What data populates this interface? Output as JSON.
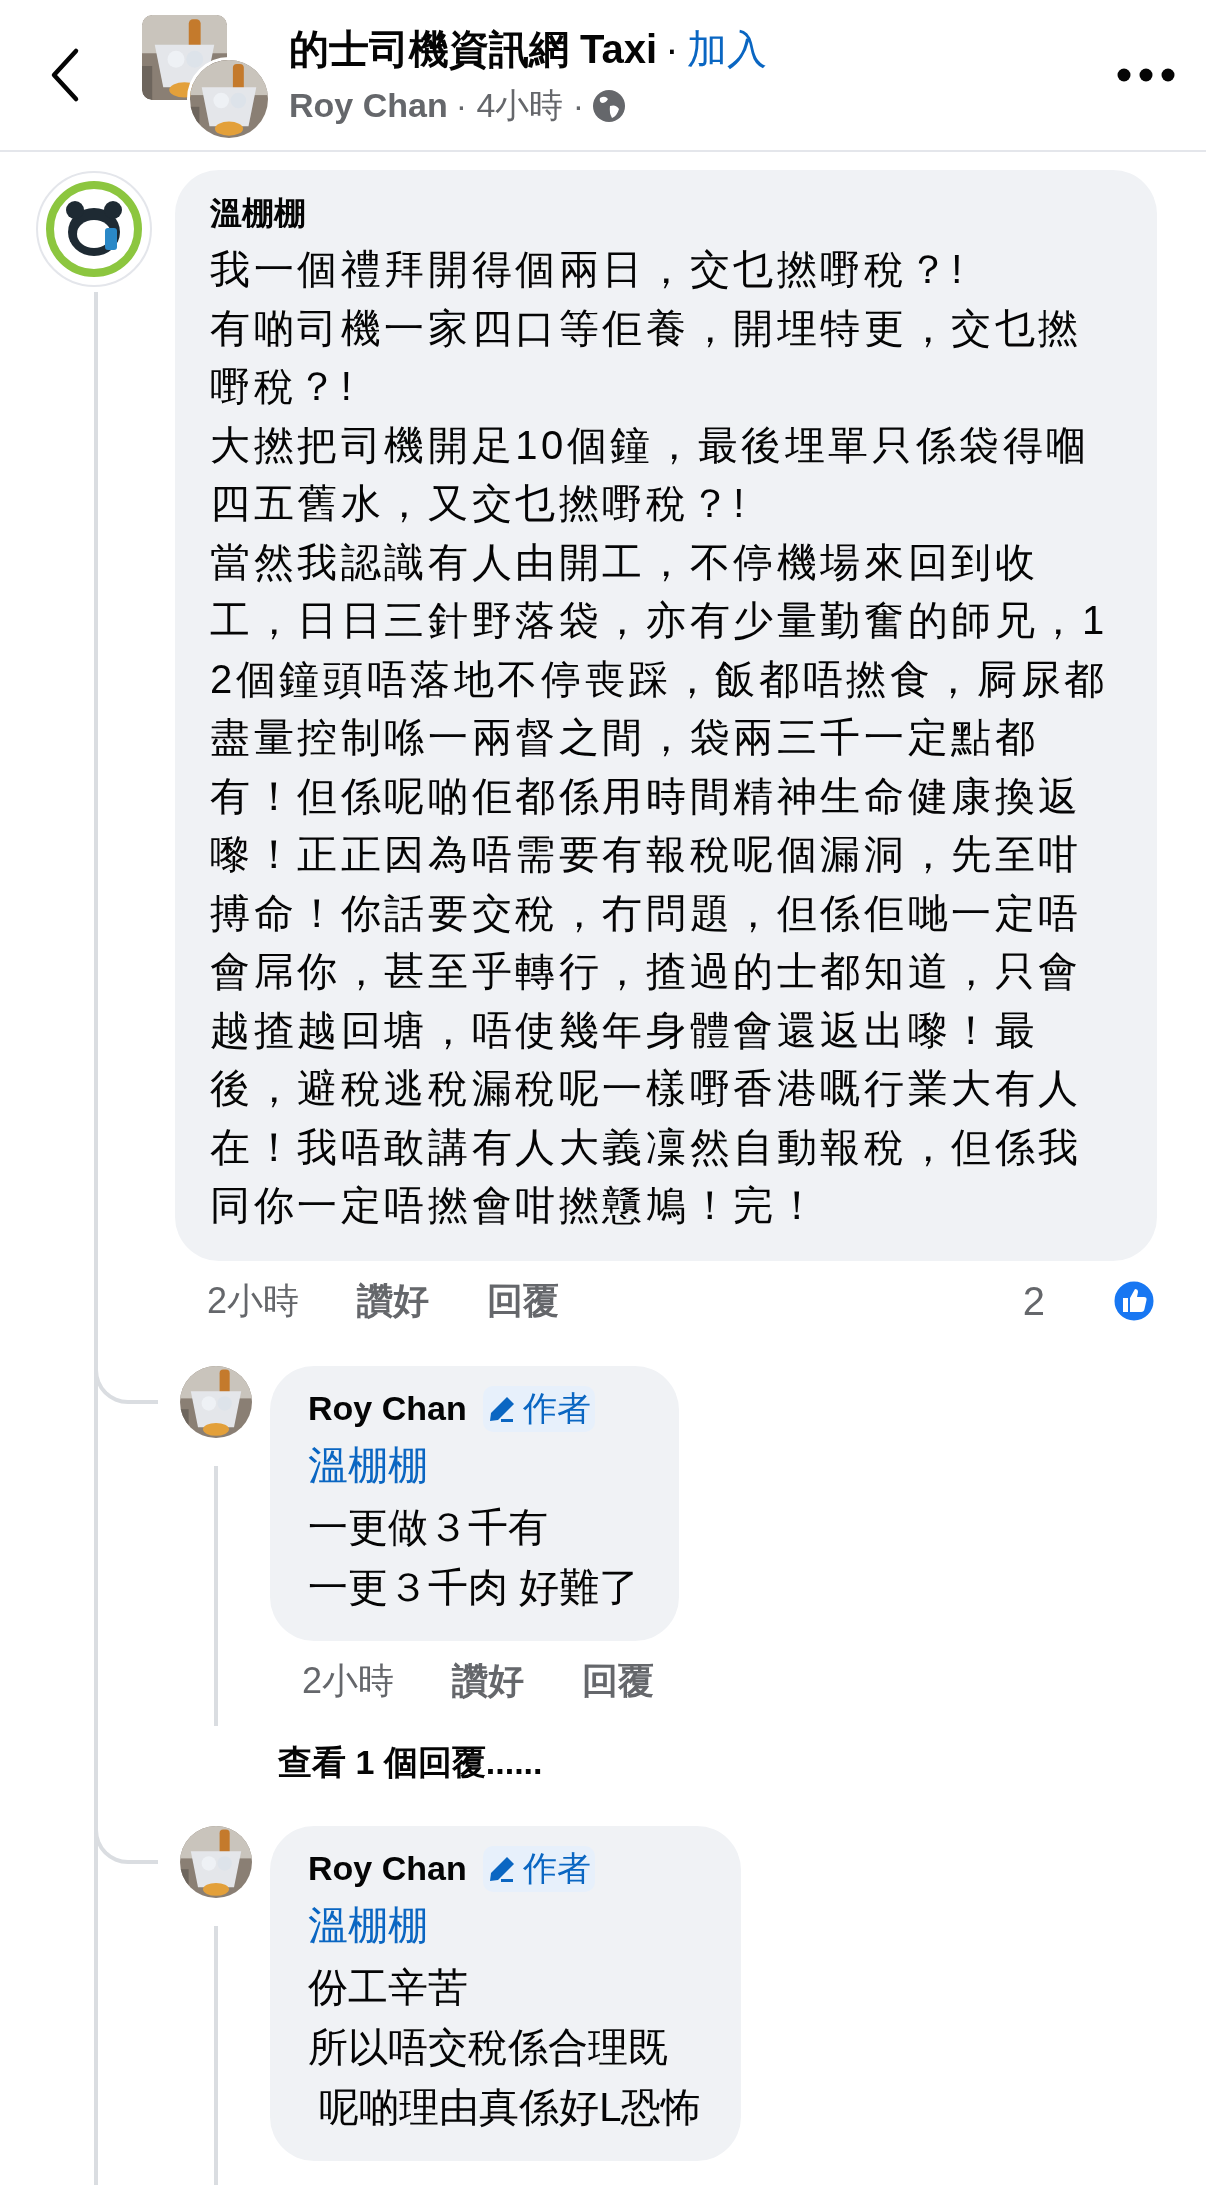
{
  "header": {
    "group_name": "的士司機資訊網 Taxi",
    "separator": "·",
    "join": "加入",
    "author": "Roy Chan",
    "time": "· 4小時 ·"
  },
  "comment": {
    "author": "溫棚棚",
    "paragraphs": [
      "我一個禮拜開得個兩日，交乜撚嘢稅？!",
      "有啲司機一家四口等佢養，開埋特更，交乜撚嘢稅？!",
      "大撚把司機開足10個鐘，最後埋單只係袋得嗰四五舊水，又交乜撚嘢稅？!",
      "當然我認識有人由開工，不停機場來回到收工，日日三針野落袋，亦有少量勤奮的師兄，12個鐘頭唔落地不停喪踩，飯都唔撚食，屙尿都盡量控制喺一兩督之間，袋兩三千一定點都有！但係呢啲佢都係用時間精神生命健康換返嚟！正正因為唔需要有報稅呢個漏洞，先至咁搏命！你話要交稅，冇問題，但係佢哋一定唔會屌你，甚至乎轉行，揸過的士都知道，只會越揸越回塘，唔使幾年身體會還返出嚟！最後，避稅逃稅漏稅呢一樣嘢香港嘅行業大有人在！我唔敢講有人大義凜然自動報稅，但係我同你一定唔撚會咁撚戇鳩！完！"
    ],
    "time": "2小時",
    "like": "讚好",
    "reply": "回覆",
    "reaction_count": "2"
  },
  "replies": [
    {
      "author": "Roy Chan",
      "badge": "作者",
      "mention": "溫棚棚",
      "lines": [
        "一更做３千有",
        "一更３千肉 好難了"
      ],
      "time": "2小時",
      "like": "讚好",
      "reply": "回覆",
      "more": "查看 1 個回覆......"
    },
    {
      "author": "Roy Chan",
      "badge": "作者",
      "mention": "溫棚棚",
      "lines": [
        "份工辛苦",
        "所以唔交稅係合理既",
        " 呢啲理由真係好L恐怖"
      ]
    }
  ]
}
